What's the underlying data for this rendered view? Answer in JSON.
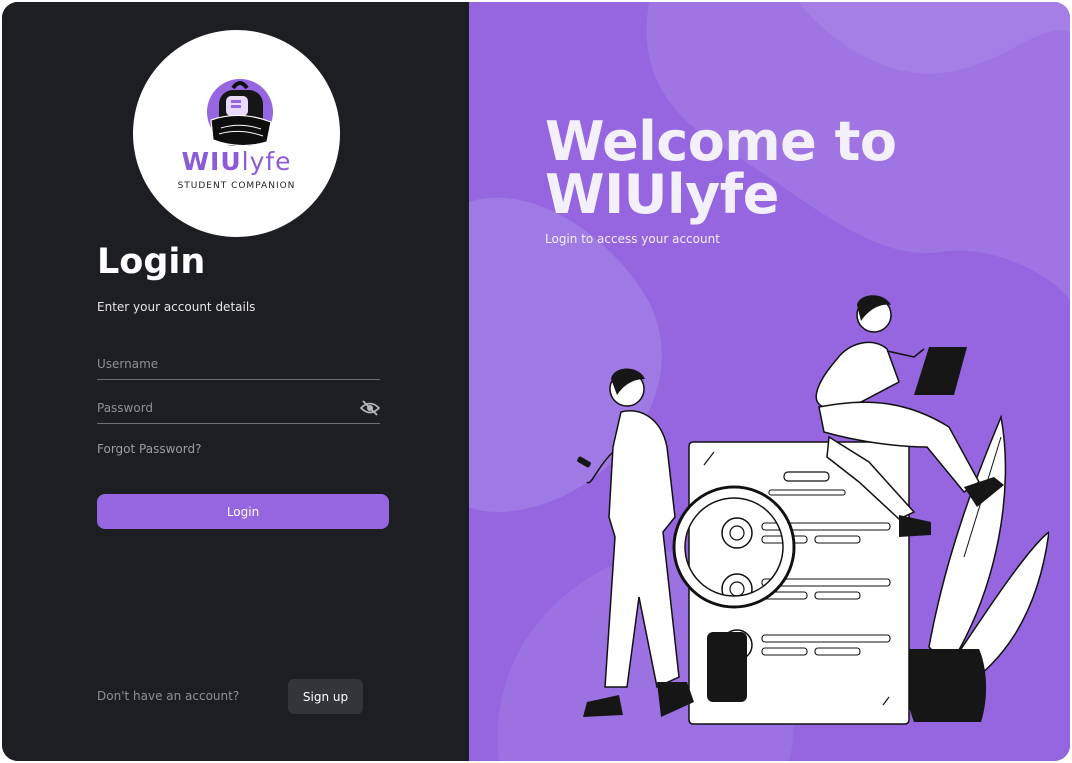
{
  "brand": {
    "name_bold": "WIU",
    "name_thin": "lyfe",
    "tagline": "STUDENT COMPANION"
  },
  "login": {
    "title": "Login",
    "subtitle": "Enter your account details",
    "username_placeholder": "Username",
    "password_placeholder": "Password",
    "forgot_label": "Forgot Password?",
    "button_label": "Login"
  },
  "signup": {
    "prompt": "Don't have an account?",
    "button_label": "Sign up"
  },
  "hero": {
    "title_line1": "Welcome to",
    "title_line2": "WIUlyfe",
    "subtitle": "Login to access your account"
  },
  "colors": {
    "accent": "#9566df",
    "panel_dark": "#1d1e22",
    "signup_bg": "#34353a"
  },
  "icons": {
    "password_toggle": "eye-off-icon",
    "logo": "backpack-icon"
  }
}
